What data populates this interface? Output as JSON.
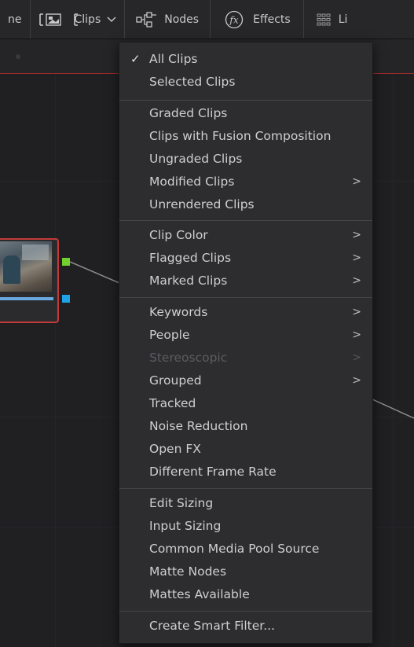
{
  "toolbar": {
    "cut_label": "ne",
    "clips_label": "Clips",
    "nodes_label": "Nodes",
    "effects_label": "Effects",
    "lightbox_label": "Li"
  },
  "menu": {
    "items": [
      {
        "label": "All Clips",
        "checked": true
      },
      {
        "label": "Selected Clips"
      },
      {
        "label": "Graded Clips"
      },
      {
        "label": "Clips with Fusion Composition"
      },
      {
        "label": "Ungraded Clips"
      },
      {
        "label": "Modified Clips",
        "submenu": true
      },
      {
        "label": "Unrendered Clips"
      },
      {
        "label": "Clip Color",
        "submenu": true
      },
      {
        "label": "Flagged Clips",
        "submenu": true
      },
      {
        "label": "Marked Clips",
        "submenu": true
      },
      {
        "label": "Keywords",
        "submenu": true
      },
      {
        "label": "People",
        "submenu": true
      },
      {
        "label": "Stereoscopic",
        "submenu": true,
        "disabled": true
      },
      {
        "label": "Grouped",
        "submenu": true
      },
      {
        "label": "Tracked"
      },
      {
        "label": "Noise Reduction"
      },
      {
        "label": "Open FX"
      },
      {
        "label": "Different Frame Rate"
      },
      {
        "label": "Edit Sizing"
      },
      {
        "label": "Input Sizing"
      },
      {
        "label": "Common Media Pool Source"
      },
      {
        "label": "Matte Nodes"
      },
      {
        "label": "Mattes Available"
      },
      {
        "label": "Create Smart Filter..."
      }
    ],
    "check_glyph": "✓",
    "submenu_glyph": ">"
  },
  "colors": {
    "accent_red": "#c23a3a",
    "port_green": "#72d12e",
    "port_blue": "#1fa3e6"
  }
}
